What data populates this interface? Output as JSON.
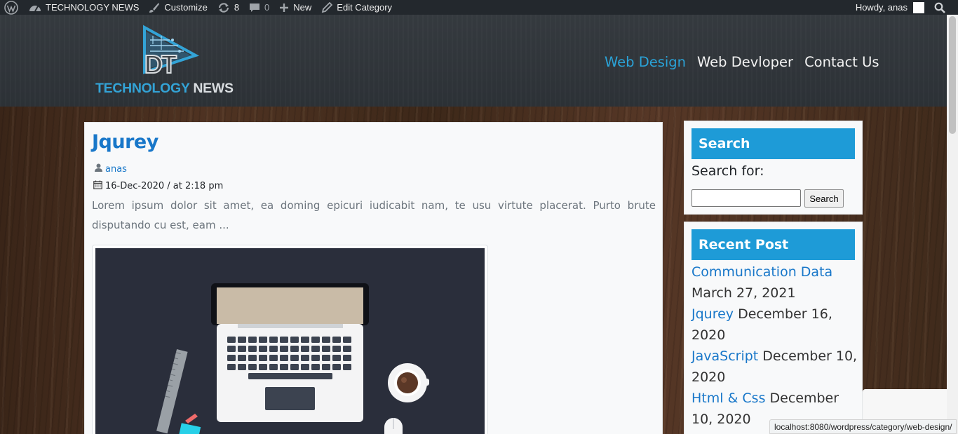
{
  "admin_bar": {
    "site_name": "TECHNOLOGY NEWS",
    "customize": "Customize",
    "updates_count": "8",
    "comments_count": "0",
    "new_label": "New",
    "edit_label": "Edit Category",
    "howdy": "Howdy, anas"
  },
  "header": {
    "logo_letters": "DT",
    "logo_text_1": "TECHNOLOGY",
    "logo_text_2": "NEWS",
    "nav": [
      {
        "label": "Web Design",
        "active": true
      },
      {
        "label": "Web Devloper",
        "active": false
      },
      {
        "label": "Contact Us",
        "active": false
      }
    ]
  },
  "post": {
    "title": "Jqurey",
    "author": "anas",
    "date": "16-Dec-2020 / at 2:18 pm",
    "excerpt": "Lorem ipsum dolor sit amet, ea doming epicuri iudicabit nam, te usu virtute placerat. Purto brute disputando cu est, eam ..."
  },
  "sidebar": {
    "search": {
      "title": "Search",
      "label": "Search for:",
      "button": "Search",
      "value": ""
    },
    "recent": {
      "title": "Recent Post",
      "items": [
        {
          "title": "Communication Data",
          "date": "March 27, 2021"
        },
        {
          "title": "Jqurey",
          "date": "December 16, 2020"
        },
        {
          "title": "JavaScript",
          "date": "December 10, 2020"
        },
        {
          "title": "Html & Css",
          "date": "December 10, 2020"
        }
      ]
    }
  },
  "status_url": "localhost:8080/wordpress/category/web-design/",
  "colors": {
    "accent": "#1e9bd7",
    "link": "#1877c9",
    "admin_bar": "#23282d",
    "nav_active": "#2aa3d8"
  }
}
